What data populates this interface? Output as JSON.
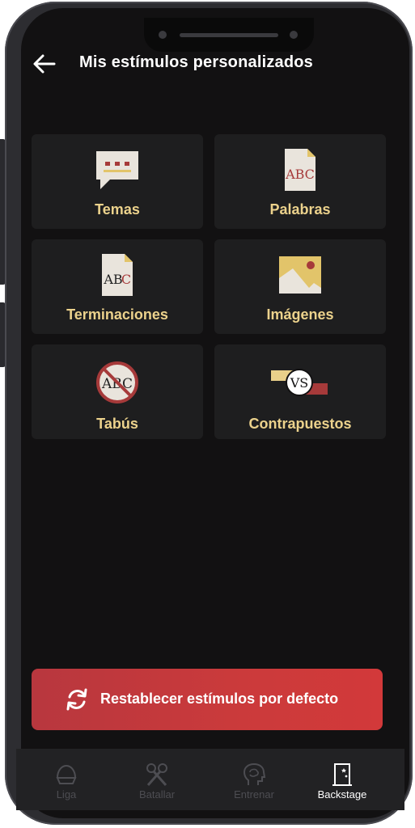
{
  "header": {
    "title": "Mis estímulos personalizados"
  },
  "categories": [
    {
      "label": "Temas",
      "icon": "chat-bubble-icon"
    },
    {
      "label": "Palabras",
      "icon": "abc-document-icon"
    },
    {
      "label": "Terminaciones",
      "icon": "abc-ending-document-icon"
    },
    {
      "label": "Imágenes",
      "icon": "image-icon"
    },
    {
      "label": "Tabús",
      "icon": "forbidden-abc-icon"
    },
    {
      "label": "Contrapuestos",
      "icon": "versus-icon"
    }
  ],
  "reset_button": {
    "label": "Restablecer estímulos por defecto",
    "icon": "refresh-icon"
  },
  "tabbar": {
    "items": [
      {
        "label": "Liga",
        "icon": "helmet-icon",
        "active": false
      },
      {
        "label": "Batallar",
        "icon": "crossed-microphones-icon",
        "active": false
      },
      {
        "label": "Entrenar",
        "icon": "brain-head-icon",
        "active": false
      },
      {
        "label": "Backstage",
        "icon": "door-icon",
        "active": true
      }
    ]
  },
  "colors": {
    "background": "#121112",
    "tile": "#1e1e1f",
    "accent_text": "#ecd28c",
    "reset_button": "#cb3a3b",
    "tabbar": "#222224",
    "inactive_tab": "#4d4d52"
  }
}
